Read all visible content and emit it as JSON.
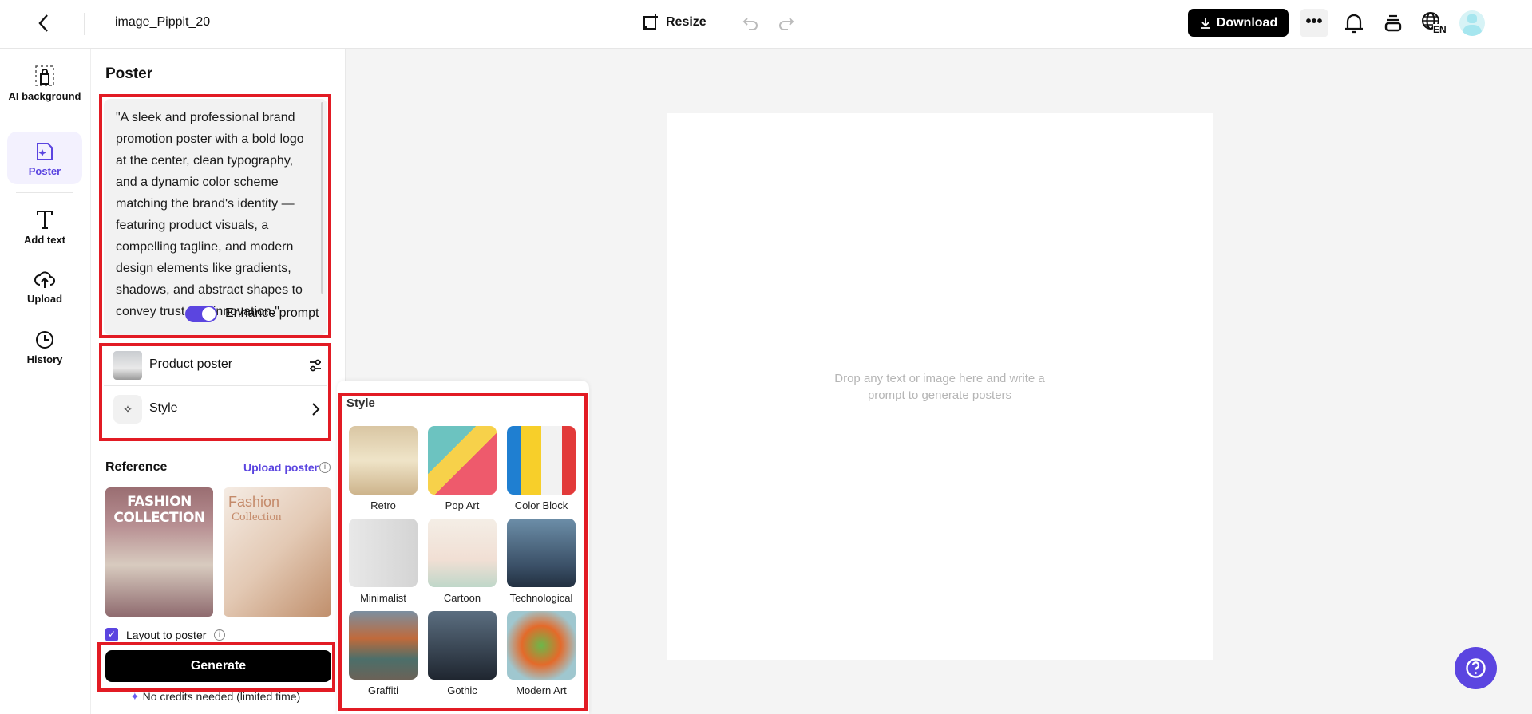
{
  "header": {
    "title": "image_Pippit_20",
    "resize_label": "Resize",
    "download_label": "Download",
    "lang_badge": "EN"
  },
  "rail": {
    "items": [
      {
        "label": "AI background",
        "icon": "ai-background-icon"
      },
      {
        "label": "Poster",
        "icon": "poster-icon",
        "active": true
      },
      {
        "label": "Add text",
        "icon": "text-icon"
      },
      {
        "label": "Upload",
        "icon": "upload-icon"
      },
      {
        "label": "History",
        "icon": "history-icon"
      }
    ]
  },
  "panel": {
    "title": "Poster",
    "prompt": "\"A sleek and professional brand promotion poster with a bold logo at the center, clean typography, and a dynamic color scheme matching the brand's identity — featuring product visuals, a compelling tagline, and modern design elements like gradients, shadows, and abstract shapes to convey trust and innovation.\"",
    "enhance_label": "Enhance prompt",
    "enhance_on": true,
    "product_label": "Product poster",
    "style_label": "Style",
    "reference_label": "Reference",
    "upload_poster_label": "Upload poster",
    "ref1_line1": "FASHION",
    "ref1_line2": "COLLECTION",
    "ref2_line1": "Fashion",
    "ref2_line2": "Collection",
    "layout_label": "Layout to poster",
    "layout_checked": true,
    "generate_label": "Generate",
    "credits_note": "No credits needed (limited time)"
  },
  "style_popover": {
    "title": "Style",
    "items": [
      "Retro",
      "Pop Art",
      "Color Block",
      "Minimalist",
      "Cartoon",
      "Technological",
      "Graffiti",
      "Gothic",
      "Modern Art"
    ]
  },
  "canvas": {
    "hint": "Drop any text or image here and write a prompt to generate posters"
  },
  "colors": {
    "accent": "#5b45e0",
    "highlight": "#e21b24",
    "active_bg": "#f3f1fe"
  }
}
